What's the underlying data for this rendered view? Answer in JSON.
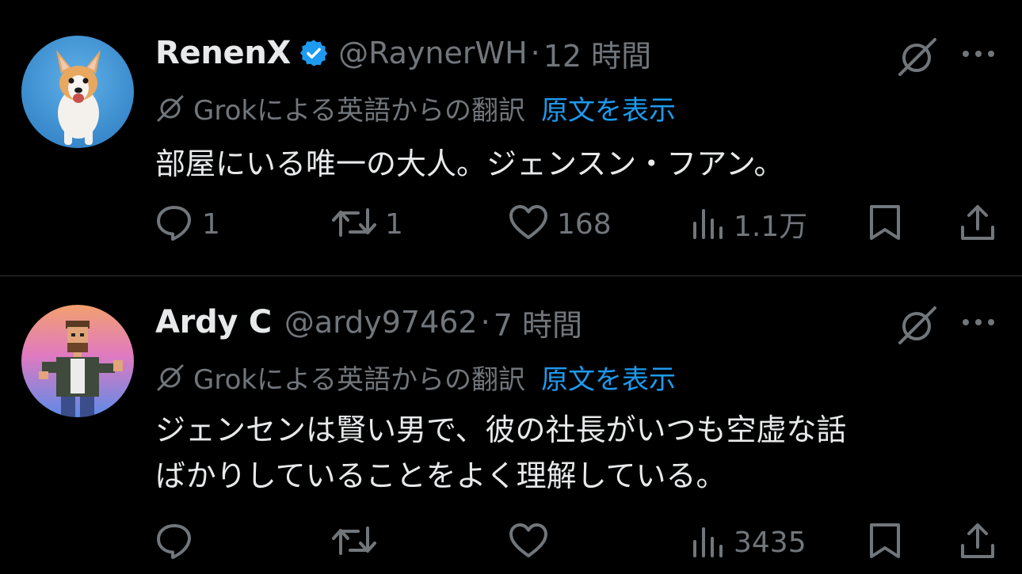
{
  "colors": {
    "background": "#000000",
    "text_primary": "#e7e9ea",
    "text_secondary": "#71767b",
    "link_blue": "#1d9bf0",
    "verified_blue": "#1d9bf0",
    "divider": "#2f3336"
  },
  "tweets": [
    {
      "display_name": "RenenX",
      "verified": true,
      "handle": "@RaynerWH",
      "separator": "·",
      "time": "12 時間",
      "translation_note": "Grokによる英語からの翻訳",
      "show_original": "原文を表示",
      "body_lines": [
        "部屋にいる唯一の大人。ジェンスン・フアン。"
      ],
      "actions": {
        "reply_count": "1",
        "retweet_count": "1",
        "like_count": "168",
        "view_count": "1.1万"
      },
      "icons": {
        "avatar": "corgi-dog-avatar",
        "grok": "grok-icon",
        "more": "more-icon"
      }
    },
    {
      "display_name": "Ardy C",
      "verified": false,
      "handle": "@ardy97462",
      "separator": "·",
      "time": "7 時間",
      "translation_note": "Grokによる英語からの翻訳",
      "show_original": "原文を表示",
      "body_lines": [
        "ジェンセンは賢い男で、彼の社長がいつも空虚な話",
        "ばかりしていることをよく理解している。"
      ],
      "actions": {
        "reply_count": "",
        "retweet_count": "",
        "like_count": "",
        "view_count": "3435"
      },
      "icons": {
        "avatar": "pixel-art-man-avatar",
        "grok": "grok-icon",
        "more": "more-icon"
      }
    }
  ]
}
